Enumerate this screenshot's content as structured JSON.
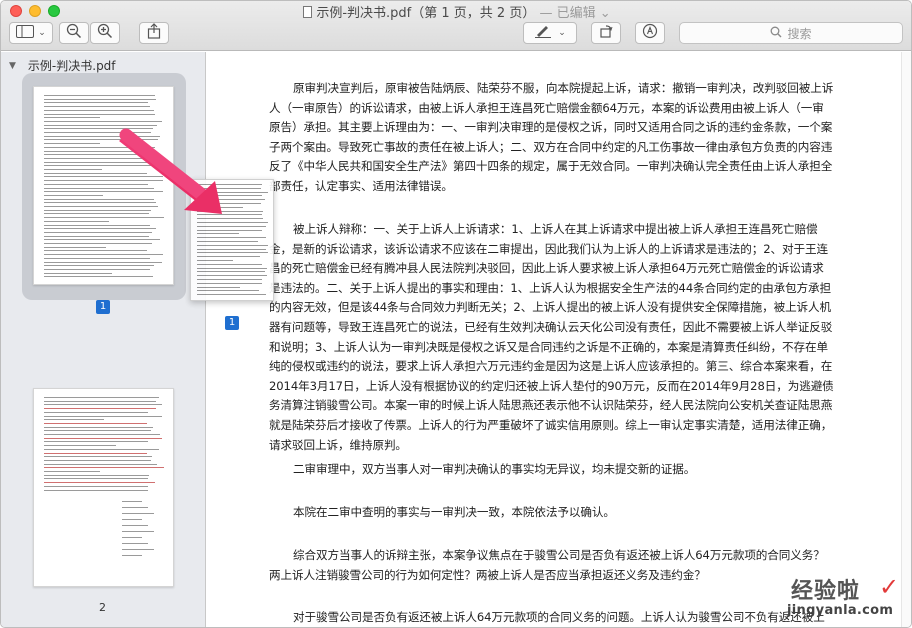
{
  "window": {
    "title_file": "示例-判决书.pdf",
    "title_pages": "（第 1 页，共 2 页）",
    "title_edited": "— 已编辑 ⌄"
  },
  "toolbar": {
    "sidebar_toggle_icon": "sidebar-icon",
    "zoom_out_icon": "zoom-out-icon",
    "zoom_in_icon": "zoom-in-icon",
    "share_icon": "share-icon",
    "markup_icon": "pen-icon",
    "rotate_icon": "rotate-icon",
    "annotate_icon": "annotate-icon",
    "search_placeholder": "搜索"
  },
  "sidebar": {
    "file_name": "示例-判决书.pdf",
    "pages": [
      {
        "label": "1",
        "selected": true
      },
      {
        "label": "2",
        "selected": false
      }
    ],
    "drag_page_label": "1"
  },
  "document": {
    "paragraphs": [
      "原审判决宣判后，原审被告陆炳辰、陆荣芬不服，向本院提起上诉，请求：撤销一审判决，改判驳回被上诉人（一审原告）的诉讼请求，由被上诉人承担王连昌死亡赔偿金额64万元，本案的诉讼费用由被上诉人（一审原告）承担。其主要上诉理由为：一、一审判决审理的是侵权之诉，同时又适用合同之诉的违约金条款，一个案子两个案由。导致死亡事故的责任在被上诉人；二、双方在合同中约定的凡工伤事故一律由承包方负责的内容违反了《中华人民共和国安全生产法》第四十四条的规定，属于无效合同。一审判决确认完全责任由上诉人承担全部责任，认定事实、适用法律错误。",
      "被上诉人辩称：一、关于上诉人上诉请求：1、上诉人在其上诉请求中提出被上诉人承担王连昌死亡赔偿金，是新的诉讼请求，该诉讼请求不应该在二审提出，因此我们认为上诉人的上诉请求是违法的；2、对于王连昌的死亡赔偿金已经有腾冲县人民法院判决驳回，因此上诉人要求被上诉人承担64万元死亡赔偿金的诉讼请求是违法的。二、关于上诉人提出的事实和理由：1、上诉人认为根据安全生产法的44条合同约定的由承包方承担的内容无效，但是该44条与合同效力判断无关；2、上诉人提出的被上诉人没有提供安全保障措施，被上诉人机器有问题等，导致王连昌死亡的说法，已经有生效判决确认云天化公司没有责任，因此不需要被上诉人举证反驳和说明；3、上诉人认为一审判决既是侵权之诉又是合同违约之诉是不正确的，本案是清算责任纠纷，不存在单纯的侵权或违约的说法，要求上诉人承担六万元违约金是因为这是上诉人应该承担的。第三、综合本案来看，在2014年3月17日，上诉人没有根据协议的约定归还被上诉人垫付的90万元，反而在2014年9月28日，为逃避债务清算注销骏雪公司。本案一审的时候上诉人陆思燕还表示他不认识陆荣芬，经人民法院向公安机关查证陆思燕就是陆荣芬后才接收了传票。上诉人的行为严重破坏了诚实信用原则。综上一审认定事实清楚，适用法律正确，请求驳回上诉，维持原判。",
      "二审审理中，双方当事人对一审判决确认的事实均无异议，均未提交新的证据。",
      "本院在二审中查明的事实与一审判决一致，本院依法予以确认。",
      "综合双方当事人的诉辩主张，本案争议焦点在于骏雪公司是否负有返还被上诉人64万元款项的合同义务？两上诉人注销骏雪公司的行为如何定性？两被上诉人是否应当承担返还义务及违约金？",
      "对于骏雪公司是否负有返还被上诉人64万元款项的合同义务的问题。上诉人认为骏雪公司不负有返还被上诉人"
    ]
  },
  "watermark": {
    "cn_text": "经验啦",
    "check": "✓",
    "url": "jingyanla.com"
  }
}
